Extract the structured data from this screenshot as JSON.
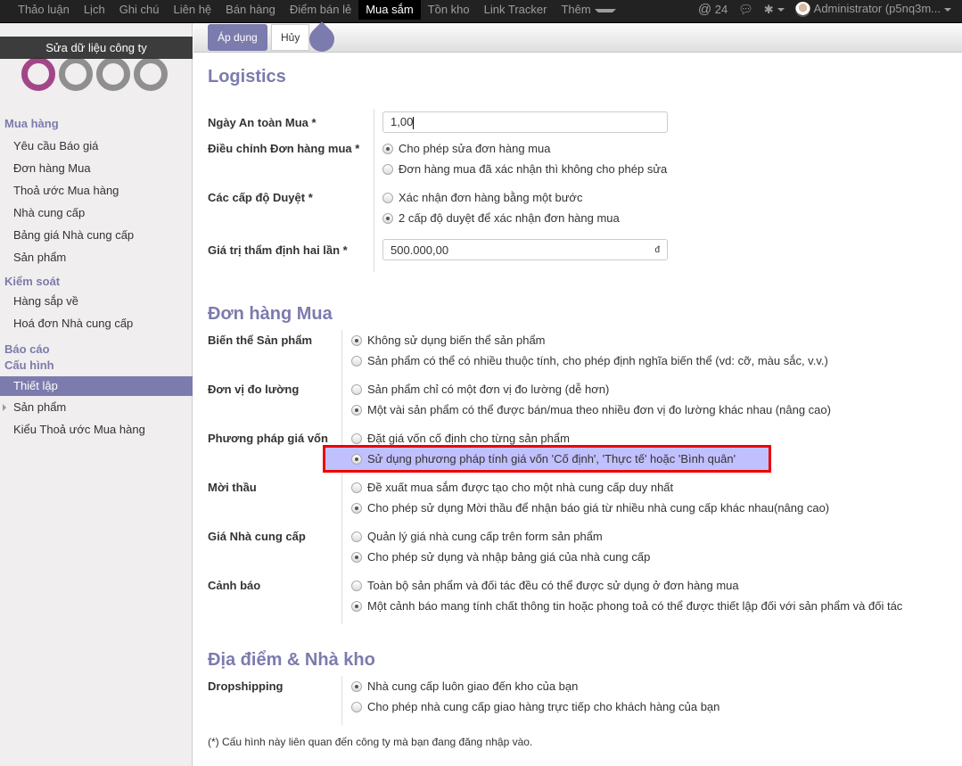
{
  "topbar": {
    "menu": [
      "Thảo luận",
      "Lịch",
      "Ghi chú",
      "Liên hệ",
      "Bán hàng",
      "Điểm bán lẻ",
      "Mua sắm",
      "Tồn kho",
      "Link Tracker",
      "Thêm"
    ],
    "active": "Mua sắm",
    "mention_count": "24",
    "user": "Administrator (p5nq3m..."
  },
  "sidebar": {
    "company_edit": "Sửa dữ liệu công ty",
    "groups": [
      {
        "title": "Mua hàng",
        "items": [
          "Yêu cầu Báo giá",
          "Đơn hàng Mua",
          "Thoả ước Mua hàng",
          "Nhà cung cấp",
          "Bảng giá Nhà cung cấp",
          "Sản phẩm"
        ]
      },
      {
        "title": "Kiểm soát",
        "items": [
          "Hàng sắp về",
          "Hoá đơn Nhà cung cấp"
        ]
      },
      {
        "title": "Báo cáo",
        "items": []
      },
      {
        "title": "Cấu hình",
        "items": [
          "Thiết lập",
          "Sản phẩm",
          "Kiểu Thoả ước Mua hàng"
        ]
      }
    ],
    "selected": "Thiết lập"
  },
  "toolbar": {
    "apply": "Áp dụng",
    "cancel": "Hủy"
  },
  "sections": [
    {
      "title": "Logistics",
      "rows": [
        {
          "label": "Ngày An toàn Mua *",
          "input": "1,00"
        },
        {
          "label": "Điều chỉnh Đơn hàng mua *",
          "options": [
            "Cho phép sửa đơn hàng mua",
            "Đơn hàng mua đã xác nhận thì không cho phép sửa"
          ],
          "selected": 0
        },
        {
          "label": "Các cấp độ Duyệt *",
          "options": [
            "Xác nhận đơn hàng bằng một bước",
            "2 cấp độ duyệt để xác nhận đơn hàng mua"
          ],
          "selected": 1
        },
        {
          "label": "Giá trị thẩm định hai lần *",
          "input": "500.000,00",
          "suffix": "đ"
        }
      ]
    },
    {
      "title": "Đơn hàng Mua",
      "rows": [
        {
          "label": "Biến thể Sản phẩm",
          "options": [
            "Không sử dụng biến thể sản phẩm",
            "Sản phẩm có thể có nhiều thuộc tính, cho phép định nghĩa biến thể (vd: cỡ, màu sắc, v.v.)"
          ],
          "selected": 0
        },
        {
          "label": "Đơn vị đo lường",
          "options": [
            "Sản phẩm chỉ có một đơn vị đo lường (dễ hơn)",
            "Một vài sản phẩm có thể được bán/mua theo nhiều đơn vị đo lường khác nhau (nâng cao)"
          ],
          "selected": 1
        },
        {
          "label": "Phương pháp giá vốn",
          "options": [
            "Đặt giá vốn cố định cho từng sản phẩm",
            "Sử dụng phương pháp tính giá vốn 'Cố định', 'Thực tế' hoặc 'Bình quân'"
          ],
          "selected": 1,
          "highlighted": 1
        },
        {
          "label": "Mời thầu",
          "options": [
            "Đề xuất mua sắm được tạo cho một nhà cung cấp duy nhất",
            "Cho phép sử dụng Mời thầu để nhận báo giá từ nhiều nhà cung cấp khác nhau(nâng cao)"
          ],
          "selected": 1
        },
        {
          "label": "Giá Nhà cung cấp",
          "options": [
            "Quản lý giá nhà cung cấp trên form sản phẩm",
            "Cho phép sử dụng và nhập bảng giá của nhà cung cấp"
          ],
          "selected": 1
        },
        {
          "label": "Cảnh báo",
          "options": [
            "Toàn bộ sản phẩm và đối tác đều có thể được sử dụng ở đơn hàng mua",
            "Một cảnh báo mang tính chất thông tin hoặc phong toả có thể được thiết lập đối với sản phẩm và đối tác"
          ],
          "selected": 1
        }
      ]
    },
    {
      "title": "Địa điểm & Nhà kho",
      "rows": [
        {
          "label": "Dropshipping",
          "options": [
            "Nhà cung cấp luôn giao đến kho của bạn",
            "Cho phép nhà cung cấp giao hàng trực tiếp cho khách hàng của bạn"
          ],
          "selected": 0
        }
      ]
    }
  ],
  "footnote": "(*) Cấu hình này liên quan đến công ty mà bạn đang đăng nhập vào.",
  "colors": {
    "accent": "#7c7bad",
    "topbar": "#222222",
    "highlight": "#c0c0ff",
    "highlight_border": "#ee0000"
  }
}
